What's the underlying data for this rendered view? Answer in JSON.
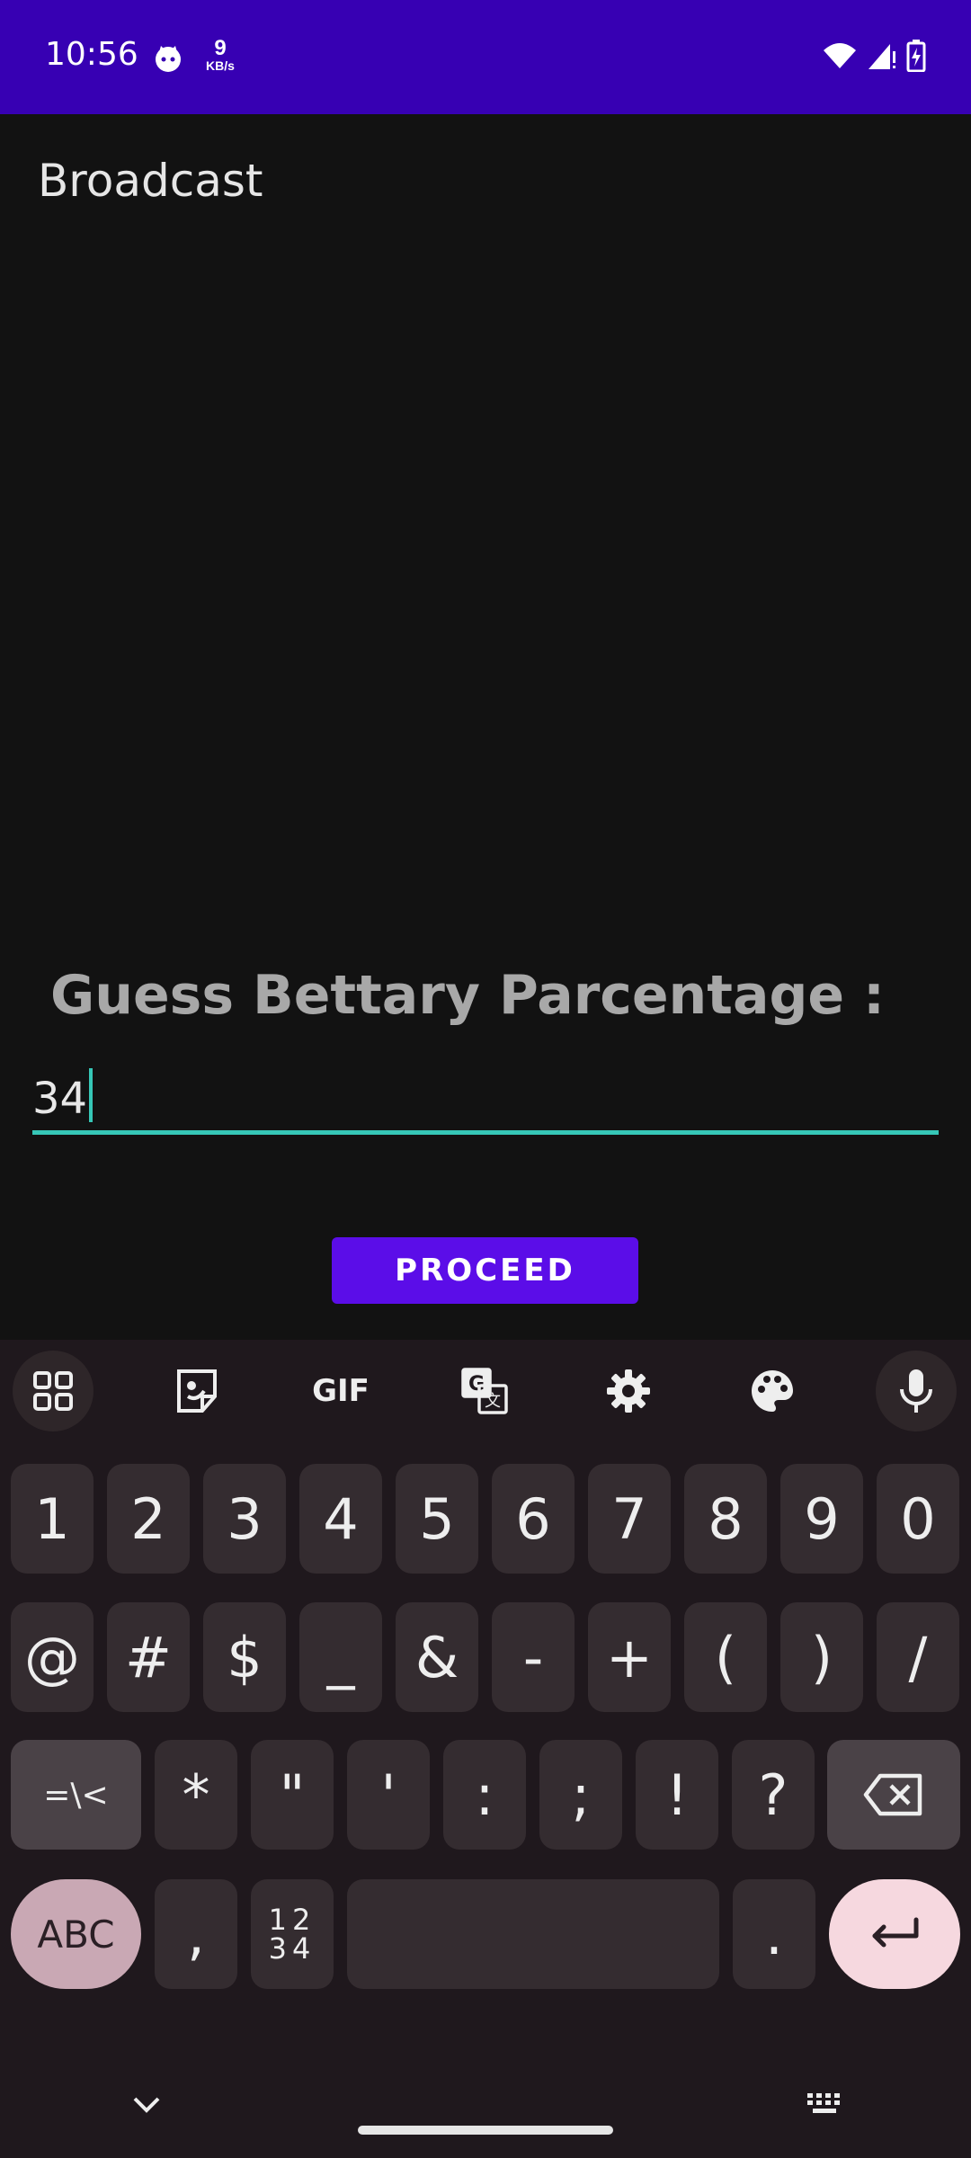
{
  "status_bar": {
    "time": "10:56",
    "speed_value": "9",
    "speed_unit": "KB/s",
    "icons": [
      "cat-notification-icon",
      "wifi-icon",
      "signal-icon",
      "battery-charging-icon"
    ]
  },
  "app": {
    "title": "Broadcast",
    "prompt": "Guess Bettary Parcentage :",
    "input_value": "34",
    "proceed_label": "PROCEED"
  },
  "keyboard": {
    "toolbar": {
      "gif_label": "GIF",
      "items": [
        "apps-grid-icon",
        "sticker-icon",
        "gif",
        "translate-icon",
        "settings-icon",
        "palette-icon",
        "mic-icon"
      ]
    },
    "row1": [
      "1",
      "2",
      "3",
      "4",
      "5",
      "6",
      "7",
      "8",
      "9",
      "0"
    ],
    "row2": [
      "@",
      "#",
      "$",
      "_",
      "&",
      "-",
      "+",
      "(",
      ")",
      "/"
    ],
    "row3": {
      "symbols_key": "=\\<",
      "keys": [
        "*",
        "\"",
        "'",
        ":",
        ";",
        "!",
        "?"
      ]
    },
    "row4": {
      "abc_label": "ABC",
      "comma": ",",
      "nums_top": "12",
      "nums_bottom": "34",
      "period": "."
    }
  },
  "colors": {
    "status_bar": "#3700b3",
    "accent_underline": "#36c7b7",
    "proceed_bg": "#5b0de8",
    "keyboard_bg": "#1f181d"
  }
}
